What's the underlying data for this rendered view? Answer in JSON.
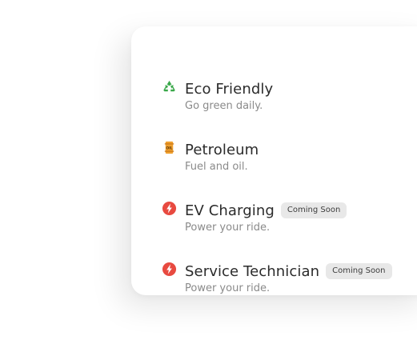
{
  "colors": {
    "recycle_green": "#3aa84a",
    "fuel_orange": "#f0a02e",
    "bolt_red": "#e84a40",
    "badge_bg": "#e8e8e8"
  },
  "items": [
    {
      "icon": "recycle-icon",
      "title": "Eco Friendly",
      "desc": "Go green daily.",
      "badge": ""
    },
    {
      "icon": "fuel-barrel-icon",
      "title": "Petroleum",
      "desc": "Fuel and oil.",
      "badge": ""
    },
    {
      "icon": "lightning-icon",
      "title": "EV Charging",
      "desc": "Power your ride.",
      "badge": "Coming Soon"
    },
    {
      "icon": "lightning-icon",
      "title": "Service Technician",
      "desc": "Power your ride.",
      "badge": "Coming Soon"
    }
  ]
}
